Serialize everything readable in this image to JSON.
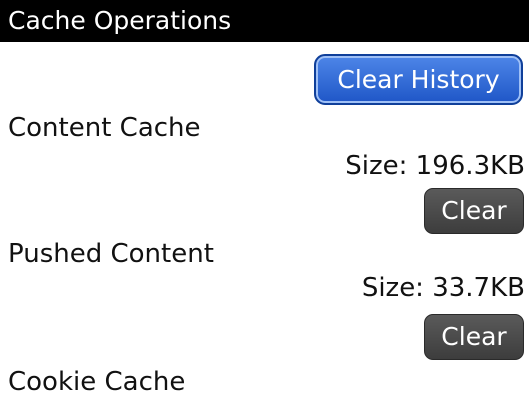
{
  "screen": {
    "title": "Cache Operations"
  },
  "history": {
    "clear_label": "Clear History"
  },
  "content_cache": {
    "label": "Content Cache",
    "size": "Size: 196.3KB",
    "clear_label": "Clear"
  },
  "pushed_content": {
    "label": "Pushed Content",
    "size": "Size: 33.7KB",
    "clear_label": "Clear"
  },
  "cookie_cache": {
    "label": "Cookie Cache"
  },
  "colors": {
    "title_bar_bg": "#000000",
    "primary_button": "#2a62d4",
    "secondary_button": "#474747"
  }
}
